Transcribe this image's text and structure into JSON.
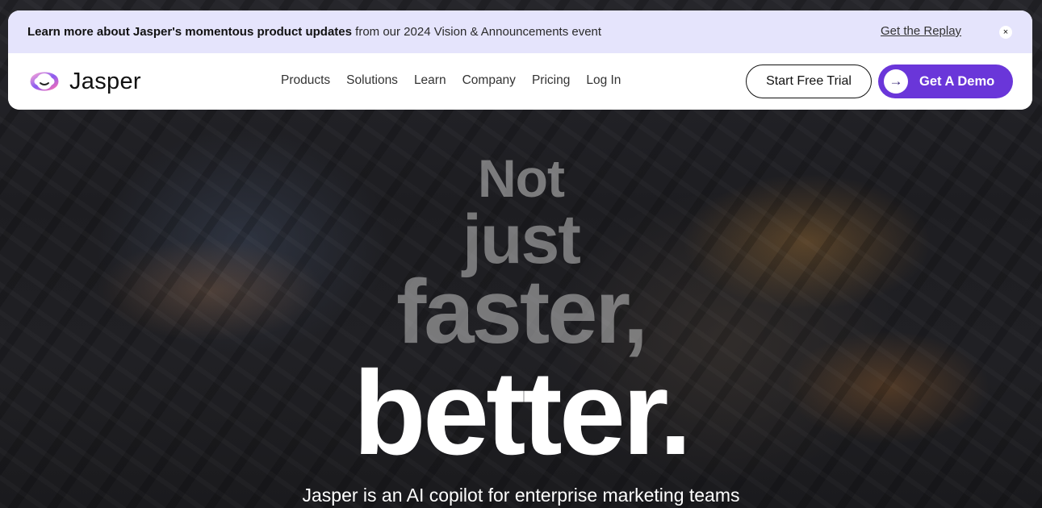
{
  "announcement": {
    "bold_text": "Learn more about Jasper's momentous product updates",
    "text": "from our 2024 Vision & Announcements event",
    "link_label": "Get the Replay",
    "close_icon": "×"
  },
  "brand": {
    "name": "Jasper",
    "accent_color": "#6a36d9"
  },
  "nav": {
    "items": [
      "Products",
      "Solutions",
      "Learn",
      "Company",
      "Pricing",
      "Log In"
    ]
  },
  "cta": {
    "trial_label": "Start Free Trial",
    "demo_label": "Get A Demo",
    "demo_icon": "→"
  },
  "hero": {
    "line1": "Not",
    "line2": "just",
    "line3": "faster,",
    "line4": "better.",
    "subtitle": "Jasper is an AI copilot for enterprise marketing teams"
  }
}
